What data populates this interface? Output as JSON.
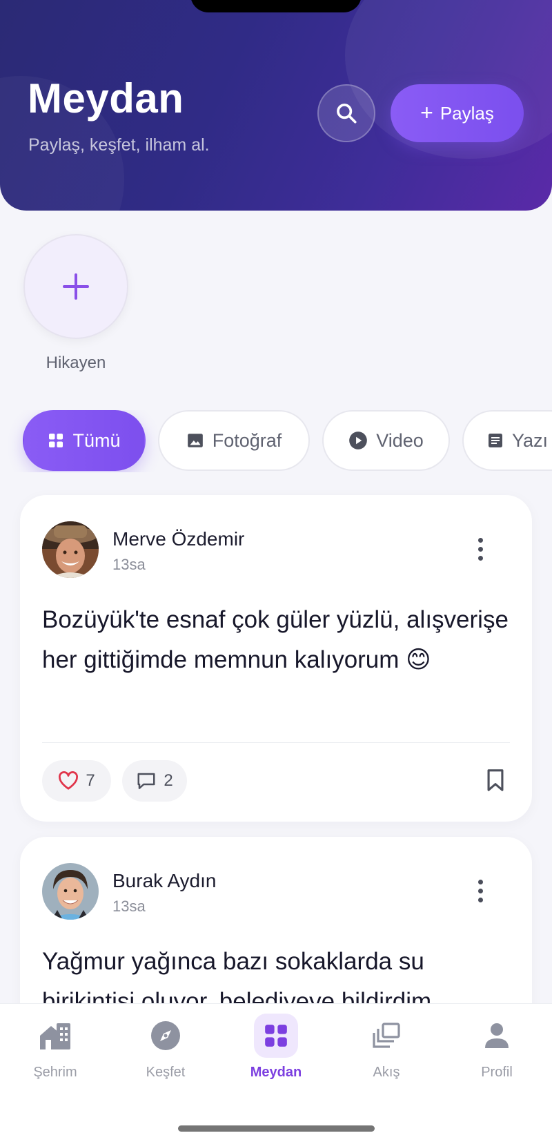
{
  "header": {
    "title": "Meydan",
    "subtitle": "Paylaş, keşfet, ilham al.",
    "share_label": "Paylaş",
    "gradient_colors": [
      "#2b2a75",
      "#5a2aa8"
    ]
  },
  "stories": {
    "add_label": "Hikayen"
  },
  "filters": [
    {
      "label": "Tümü",
      "icon": "grid-icon",
      "active": true
    },
    {
      "label": "Fotoğraf",
      "icon": "image-icon",
      "active": false
    },
    {
      "label": "Video",
      "icon": "play-icon",
      "active": false
    },
    {
      "label": "Yazı",
      "icon": "article-icon",
      "active": false
    }
  ],
  "posts": [
    {
      "author": "Merve Özdemir",
      "time": "13sa",
      "text": "Bozüyük'te esnaf çok güler yüzlü, alışverişe her gittiğimde memnun kalıyorum 😊",
      "likes": "7",
      "comments": "2"
    },
    {
      "author": "Burak Aydın",
      "time": "13sa",
      "text": "Yağmur yağınca bazı sokaklarda su birikintisi oluyor, belediyeye bildirdim."
    }
  ],
  "nav": [
    {
      "label": "Şehrim",
      "icon": "city-icon",
      "active": false
    },
    {
      "label": "Keşfet",
      "icon": "compass-icon",
      "active": false
    },
    {
      "label": "Meydan",
      "icon": "grid-icon",
      "active": true
    },
    {
      "label": "Akış",
      "icon": "stack-icon",
      "active": false
    },
    {
      "label": "Profil",
      "icon": "person-icon",
      "active": false
    }
  ],
  "accent_color": "#7c3fe0"
}
